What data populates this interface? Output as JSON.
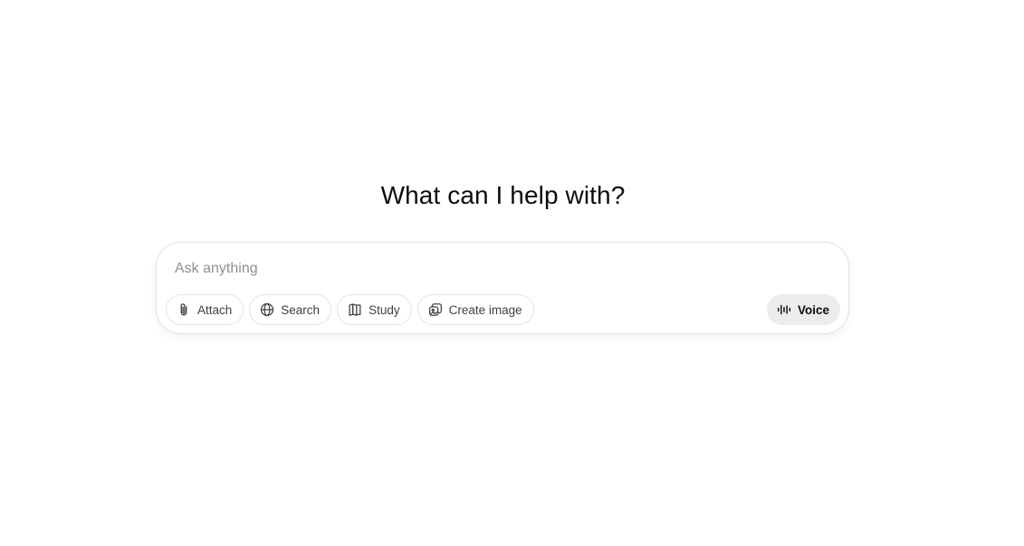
{
  "main": {
    "heading": "What can I help with?"
  },
  "composer": {
    "placeholder": "Ask anything",
    "value": ""
  },
  "tools": {
    "attach": {
      "label": "Attach",
      "icon": "paperclip-icon"
    },
    "search": {
      "label": "Search",
      "icon": "globe-icon"
    },
    "study": {
      "label": "Study",
      "icon": "book-icon"
    },
    "create_image": {
      "label": "Create image",
      "icon": "image-icon"
    }
  },
  "voice": {
    "label": "Voice",
    "icon": "voice-waveform-icon"
  },
  "colors": {
    "background": "#ffffff",
    "text": "#0d0d0d",
    "placeholder": "#8f8f8f",
    "border": "#e3e3e3",
    "voice_bg": "#ececec"
  }
}
